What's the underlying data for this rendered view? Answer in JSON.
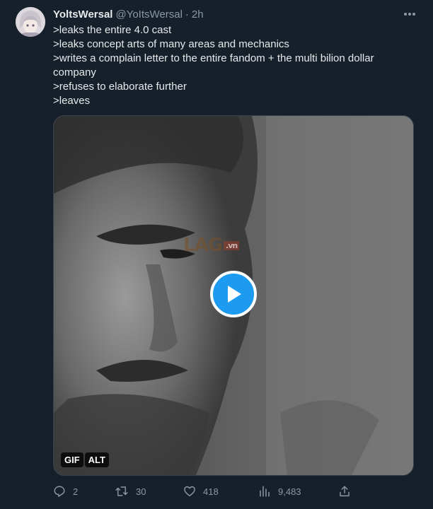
{
  "tweet": {
    "author_name": "YoltsWersal",
    "author_handle": "@YoItsWersal",
    "separator": "·",
    "time": "2h",
    "lines": [
      ">leaks the entire 4.0 cast",
      ">leaks concept arts of many areas and mechanics",
      ">writes a complain letter to the entire fandom + the multi bilion dollar",
      "company",
      ">refuses to elaborate further",
      ">leaves"
    ]
  },
  "media": {
    "gif_badge": "GIF",
    "alt_badge": "ALT",
    "watermark_main": "LAG",
    "watermark_sub": ".vn",
    "play_icon": "play-icon"
  },
  "actions": {
    "replies": "2",
    "retweets": "30",
    "likes": "418",
    "views": "9,483"
  },
  "colors": {
    "background": "#15202b",
    "text": "#e7e9ea",
    "muted": "#8b98a5",
    "accent": "#1d9bf0"
  }
}
